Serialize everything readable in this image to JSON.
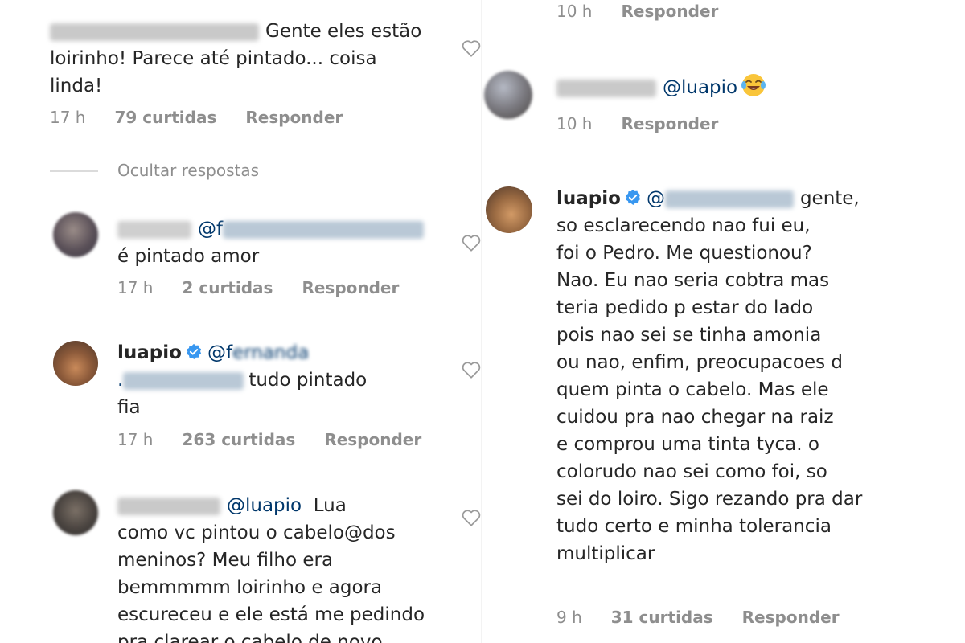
{
  "left": {
    "c1": {
      "text_line1": "Gente eles estão",
      "text_line2": "loirinho! Parece até pintado... coisa",
      "text_line3": "linda!",
      "time": "17 h",
      "likes": "79 curtidas",
      "reply": "Responder"
    },
    "hide_replies": "Ocultar respostas",
    "c2": {
      "mention": "@f",
      "text": "é pintado amor",
      "time": "17 h",
      "likes": "2 curtidas",
      "reply": "Responder"
    },
    "c3": {
      "username": "luapio",
      "mention_start": "@f",
      "mention_blur_end": "ernanda",
      "dot": ".",
      "text_after": "tudo pintado",
      "text_line3": "fia",
      "time": "17 h",
      "likes": "263 curtidas",
      "reply": "Responder"
    },
    "c4": {
      "mention": "@luapio",
      "line1_rest": "Lua",
      "line2": "como vc pintou o cabelo@dos",
      "line3": "meninos? Meu filho era",
      "line4": "bemmmmm loirinho e agora",
      "line5": "escureceu e ele está me pedindo",
      "line6": "pra clarear o cabelo de novo"
    }
  },
  "right": {
    "top_meta": {
      "time": "10 h",
      "reply": "Responder"
    },
    "c5": {
      "mention": "@luapio",
      "emoji": "laughing-crying-emoji",
      "time": "10 h",
      "reply": "Responder"
    },
    "c6": {
      "username": "luapio",
      "mention_start": "@",
      "line1_rest": "gente,",
      "lines": [
        "so esclarecendo nao fui eu,",
        "foi o Pedro. Me questionou?",
        "Nao. Eu nao seria cobtra mas",
        "teria pedido p estar do lado",
        "pois nao sei se tinha amonia",
        "ou nao, enfim, preocupacoes d",
        "quem pinta o cabelo. Mas ele",
        "cuidou pra nao chegar na raiz",
        "e comprou uma tinta tyca. o",
        "colorudo nao sei como foi, so",
        "sei do loiro. Sigo rezando pra dar",
        "tudo certo e minha tolerancia",
        "multiplicar"
      ],
      "time": "9 h",
      "likes": "31 curtidas",
      "reply": "Responder"
    }
  },
  "colors": {
    "text": "#262626",
    "meta": "#8e8e8e",
    "mention": "#00376b",
    "verified": "#3897f0"
  }
}
